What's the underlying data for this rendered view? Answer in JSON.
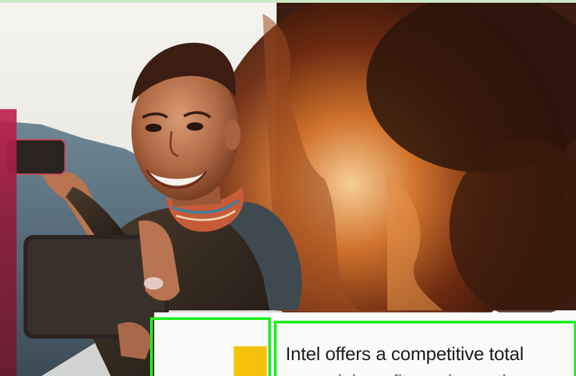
{
  "document": {
    "body_text": "Intel offers a competitive total",
    "body_text_cont": "reward, benefits and growth op"
  },
  "colors": {
    "accent_yellow": "#f6c20c",
    "accent_magenta": "#c2224e",
    "highlight_green": "#22ee22"
  }
}
